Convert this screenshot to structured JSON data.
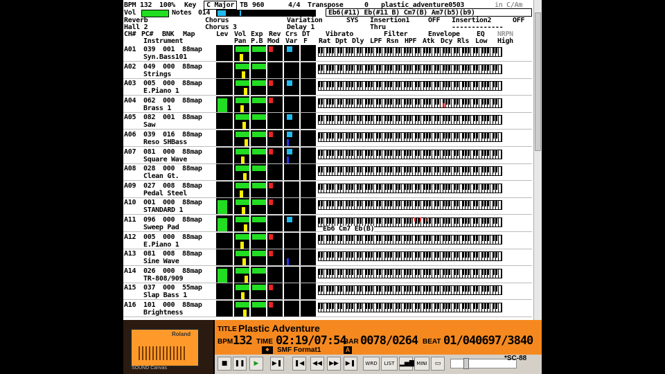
{
  "header": {
    "bpm_label": "BPM",
    "bpm_value": "132",
    "volume_pct": "100%",
    "key_label": "Key",
    "key_value": "C Major",
    "tb_label": "TB",
    "tb_value": "960",
    "time_sig": "4/4",
    "transpose_label": "Transpose",
    "transpose_value": "0",
    "song_file": "plastic_adventure0503",
    "key_suffix": "in C/Am",
    "vol_label": "Vol",
    "notes_label": "Notes",
    "notes_value": "014",
    "chords": "Eb6(#11) Eb(#11 B) Cm7(B) Am7(b5)(b9)",
    "reverb_label": "Reverb",
    "reverb_value": "Hall 2",
    "chorus_label": "Chorus",
    "chorus_value": "Chorus 3",
    "variation_label": "Variation",
    "delay_value": "Delay 1",
    "sys_label": "SYS",
    "insertion1_label": "Insertion1",
    "insertion1_state": "OFF",
    "insertion1_value": "Thru",
    "insertion2_label": "Insertion2",
    "insertion2_state": "OFF",
    "insertion2_value": "-------------"
  },
  "columns": {
    "row1": [
      "CH#",
      "PC#",
      "BNK",
      "Map",
      "Lev",
      "Vol",
      "Exp",
      "Rev",
      "Crs",
      "DT",
      "Vibrato",
      "Filter",
      "Envelope",
      "EQ",
      "NRPN"
    ],
    "row2": [
      "Instrument",
      "Pan",
      "P.B",
      "Mod",
      "Var",
      "F",
      "Rat",
      "Dpt",
      "Dly",
      "LPF",
      "Rsn",
      "HPF",
      "Atk",
      "Dcy",
      "Rls",
      "Low",
      "High"
    ]
  },
  "channels": [
    {
      "ch": "A01",
      "pc": "039",
      "bnk": "001",
      "map": "88map",
      "name": "Syn.Bass101",
      "lev": 0.0
    },
    {
      "ch": "A02",
      "pc": "049",
      "bnk": "000",
      "map": "88map",
      "name": "Strings",
      "lev": 0.0
    },
    {
      "ch": "A03",
      "pc": "005",
      "bnk": "000",
      "map": "88map",
      "name": "E.Piano 1",
      "lev": 0.0
    },
    {
      "ch": "A04",
      "pc": "062",
      "bnk": "000",
      "map": "88map",
      "name": "Brass 1",
      "lev": 0.9
    },
    {
      "ch": "A05",
      "pc": "082",
      "bnk": "001",
      "map": "88map",
      "name": "Saw",
      "lev": 0.0
    },
    {
      "ch": "A06",
      "pc": "039",
      "bnk": "016",
      "map": "88map",
      "name": "Reso SHBass",
      "lev": 0.0
    },
    {
      "ch": "A07",
      "pc": "081",
      "bnk": "000",
      "map": "88map",
      "name": "Square Wave",
      "lev": 0.0
    },
    {
      "ch": "A08",
      "pc": "028",
      "bnk": "000",
      "map": "88map",
      "name": "Clean Gt.",
      "lev": 0.0
    },
    {
      "ch": "A09",
      "pc": "027",
      "bnk": "008",
      "map": "88map",
      "name": "Pedal Steel",
      "lev": 0.0
    },
    {
      "ch": "A10",
      "pc": "001",
      "bnk": "000",
      "map": "88map",
      "name": "STANDARD 1",
      "lev": 0.9
    },
    {
      "ch": "A11",
      "pc": "096",
      "bnk": "000",
      "map": "88map",
      "name": "Sweep Pad",
      "lev": 0.85
    },
    {
      "ch": "A12",
      "pc": "005",
      "bnk": "000",
      "map": "88map",
      "name": "E.Piano 1",
      "lev": 0.0
    },
    {
      "ch": "A13",
      "pc": "081",
      "bnk": "008",
      "map": "88map",
      "name": "Sine Wave",
      "lev": 0.0
    },
    {
      "ch": "A14",
      "pc": "026",
      "bnk": "000",
      "map": "88map",
      "name": "TR-808/909",
      "lev": 0.9
    },
    {
      "ch": "A15",
      "pc": "037",
      "bnk": "000",
      "map": "55map",
      "name": "Slap Bass 1",
      "lev": 0.0
    },
    {
      "ch": "A16",
      "pc": "101",
      "bnk": "000",
      "map": "88map",
      "name": "Brightness",
      "lev": 0.0
    }
  ],
  "chord_overlay": "Eb6 Cm7 Eb(B)",
  "player": {
    "title_label": "TITLE",
    "title_value": "Plastic Adventure",
    "bpm_label": "BPM",
    "bpm_value": "132",
    "time_label": "TIME",
    "time_value": "02:19/07:54",
    "bar_label": "BAR",
    "bar_value": "0078/0264",
    "beat_label": "BEAT",
    "beat_value": "01/040697/3840",
    "format_value": "SMF Format1",
    "format_badge": "A",
    "device": "*SC-88",
    "btn_word": "WRD",
    "btn_list": "LIST",
    "btn_mini": "MINI",
    "lcd_brand": "Roland",
    "lcd_model": "SOUND Canvas"
  },
  "colors": {
    "accent": "#f5891f",
    "level": "#22dd22",
    "pan": "#ffee00",
    "mod": "#22bbee",
    "rev": "#ee2222"
  }
}
